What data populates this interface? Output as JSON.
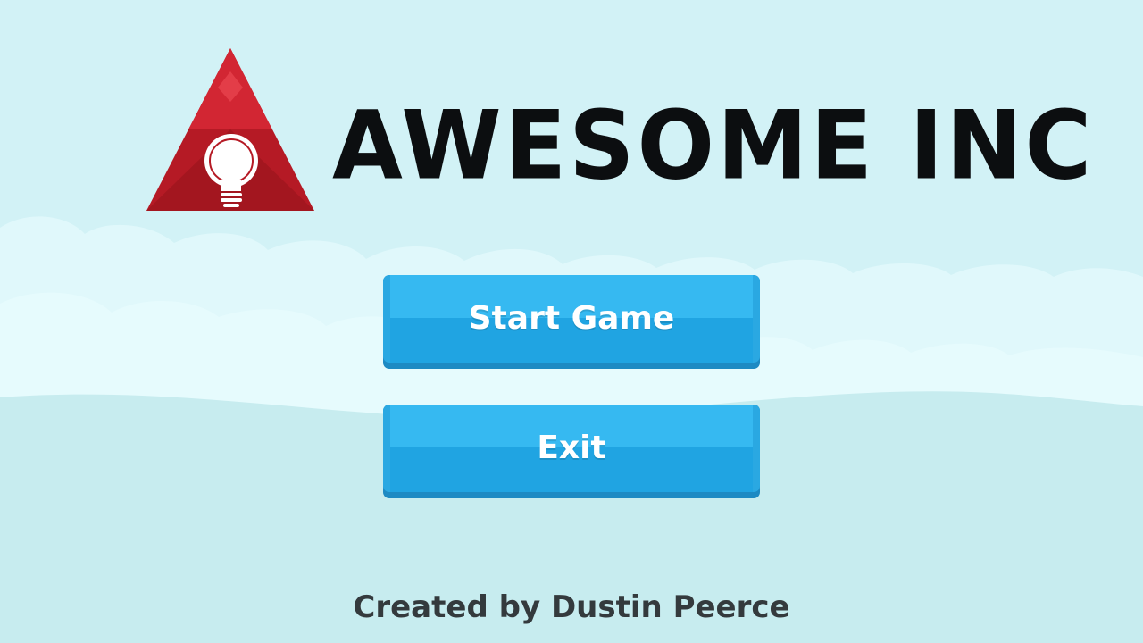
{
  "title": {
    "logo_text": "AWESOME INC",
    "logo_icon": "lightbulb-triangle-icon"
  },
  "menu": {
    "start_label": "Start Game",
    "exit_label": "Exit"
  },
  "footer": {
    "credit": "Created by Dustin Peerce"
  },
  "colors": {
    "sky": "#d2f2f6",
    "cloud": "#e6fbfd",
    "logo_red": "#c8202c",
    "button_blue": "#36b9f1",
    "title_black": "#0c0e10"
  }
}
